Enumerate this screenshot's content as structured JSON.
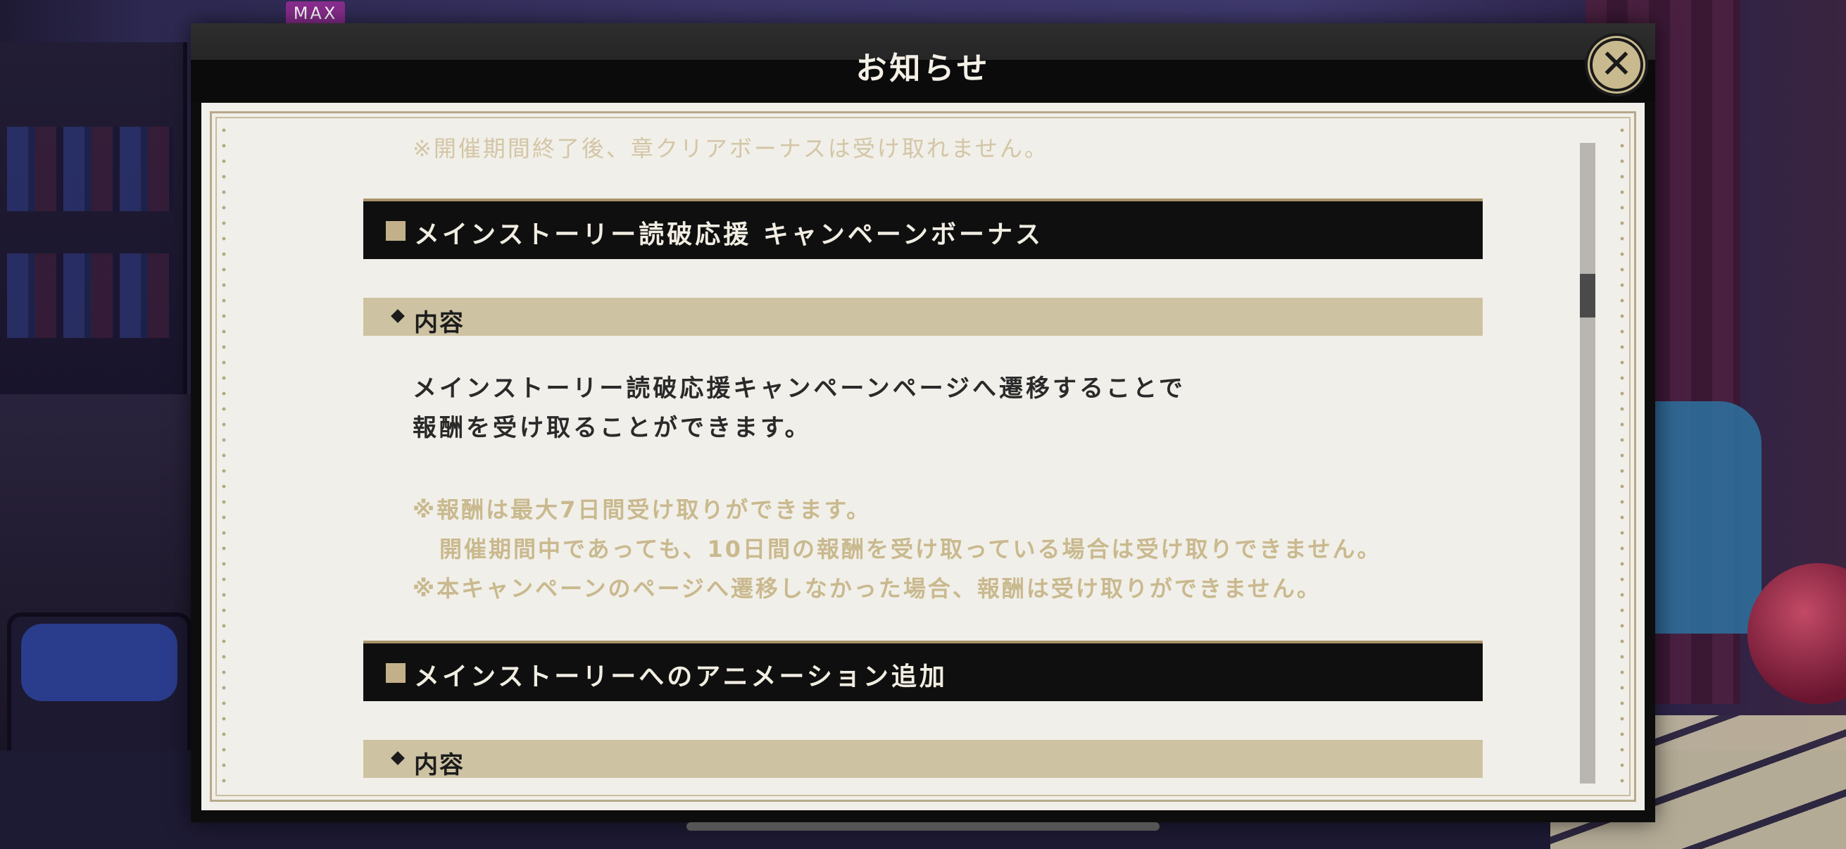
{
  "badge": {
    "max_label": "MAX"
  },
  "modal": {
    "title": "お知らせ",
    "close_icon": "close-icon"
  },
  "content": {
    "faded_top_line": "※開催期間終了後、章クリアボーナスは受け取れません。",
    "sections": [
      {
        "title": "メインストーリー読破応援 キャンペーンボーナス",
        "sub_title": "内容",
        "body_lines": [
          "メインストーリー読破応援キャンペーンページへ遷移することで",
          "報酬を受け取ることができます。"
        ],
        "notes": [
          "※報酬は最大7日間受け取りができます。",
          "開催期間中であっても、10日間の報酬を受け取っている場合は受け取りできません。",
          "※本キャンペーンのページへ遷移しなかった場合、報酬は受け取りができません。"
        ]
      },
      {
        "title": "メインストーリーへのアニメーション追加",
        "sub_title": "内容"
      }
    ]
  },
  "colors": {
    "header_bg": "#0f0f0f",
    "sub_header_bg": "#cdc2a2",
    "note_text": "#c9b98e",
    "panel_bg": "#f1efe9",
    "accent_gold": "#c2b08b"
  }
}
